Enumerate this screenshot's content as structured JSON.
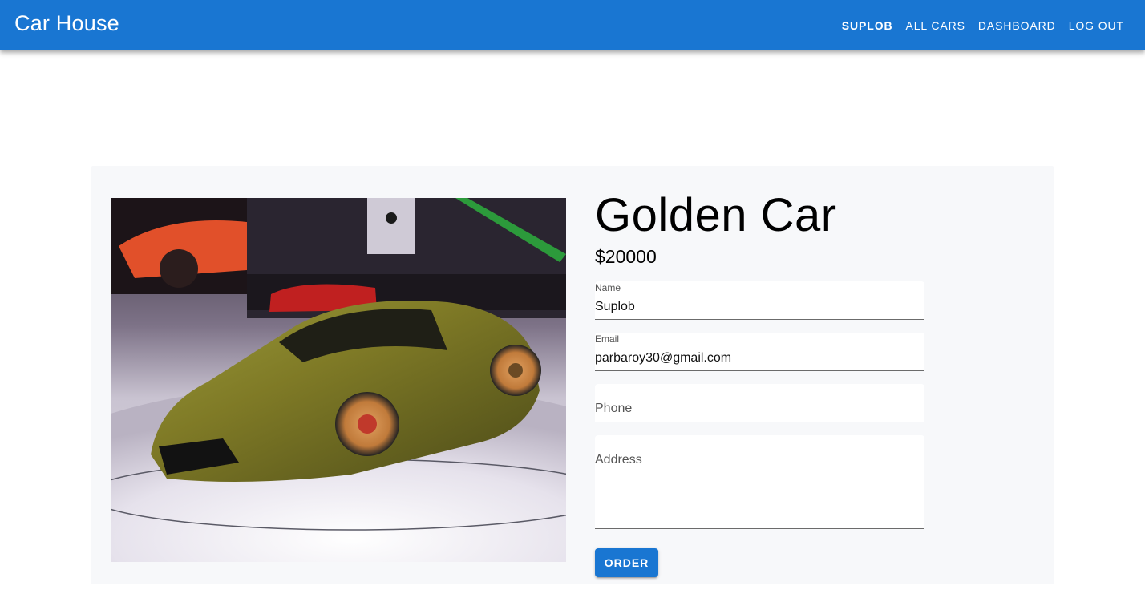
{
  "app": {
    "brand": "Car House"
  },
  "nav": {
    "user": "SUPLOB",
    "all_cars": "ALL CARS",
    "dashboard": "DASHBOARD",
    "logout": "LOG OUT"
  },
  "product": {
    "title": "Golden Car",
    "price": "$20000"
  },
  "form": {
    "name_label": "Name",
    "name_value": "Suplob",
    "email_label": "Email",
    "email_value": "parbaroy30@gmail.com",
    "phone_label": "Phone",
    "address_label": "Address",
    "order_label": "ORDER"
  },
  "colors": {
    "primary": "#1976d2",
    "panel": "#f7f8fa"
  }
}
